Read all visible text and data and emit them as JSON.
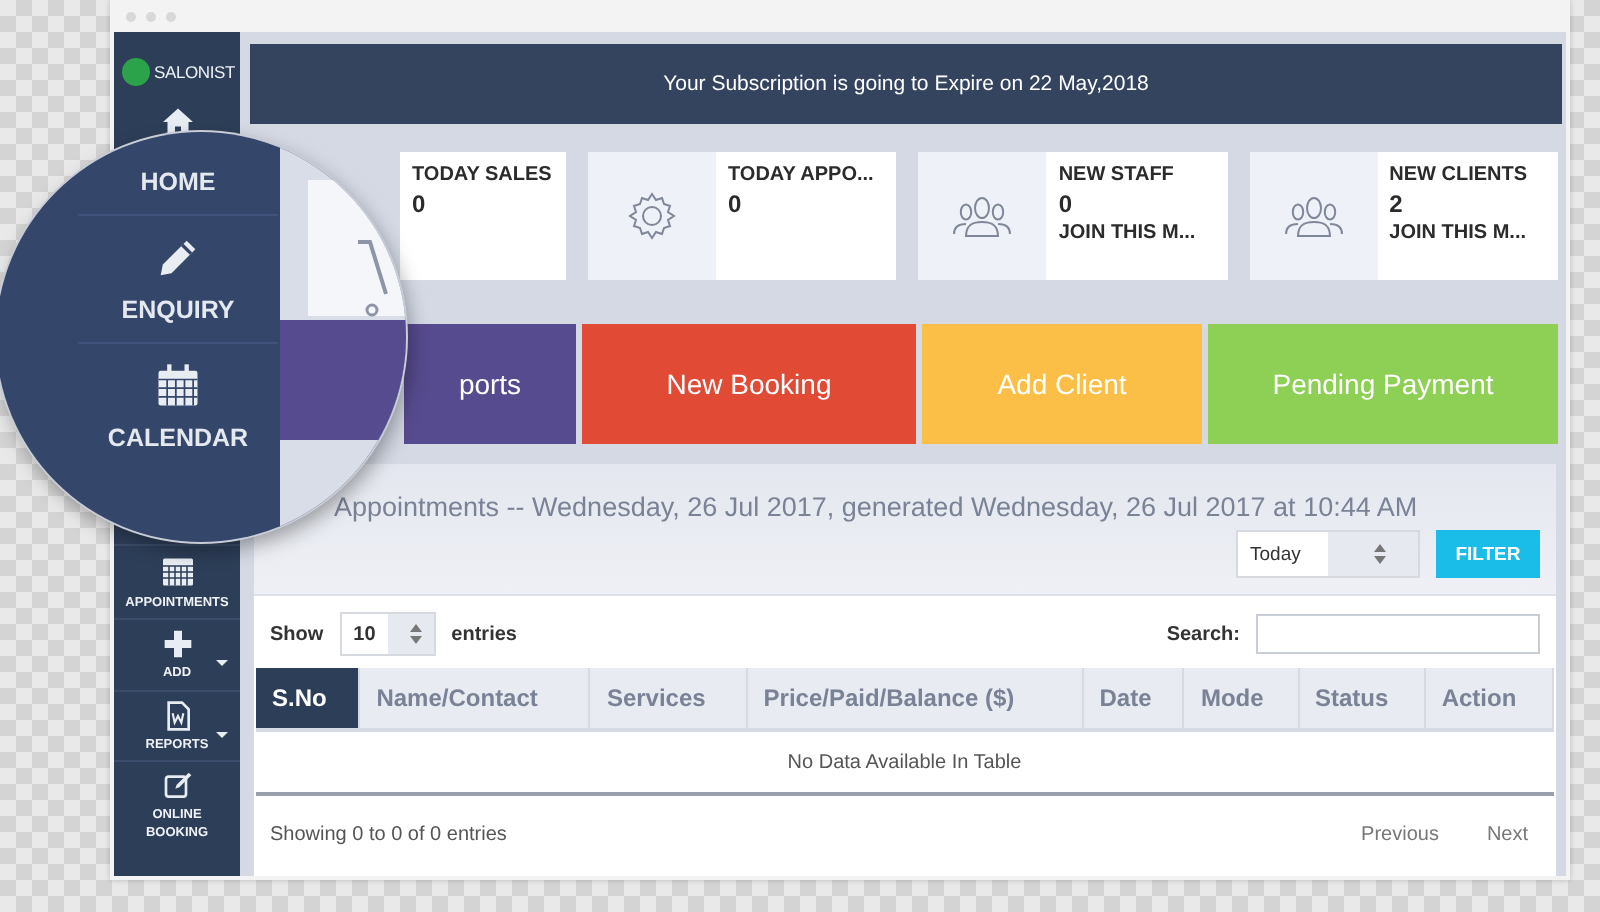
{
  "sidebar": {
    "logo": "SALONIST",
    "items": [
      {
        "label": "APPOINTMENTS",
        "has_menu": false
      },
      {
        "label": "ADD",
        "has_menu": true
      },
      {
        "label": "REPORTS",
        "has_menu": true
      },
      {
        "label": "ONLINE BOOKING",
        "has_menu": false
      }
    ]
  },
  "magnifier": {
    "items": [
      {
        "label": "HOME"
      },
      {
        "label": "ENQUIRY"
      },
      {
        "label": "CALENDAR"
      }
    ]
  },
  "banner": "Your Subscription is going to Expire on 22 May,2018",
  "stat_cards": [
    {
      "title": "TODAY SALES",
      "value": "0"
    },
    {
      "title": "TODAY APPO...",
      "value": "0"
    },
    {
      "title": "NEW STAFF",
      "value": "0",
      "note": "JOIN THIS M..."
    },
    {
      "title": "NEW CLIENTS",
      "value": "2",
      "note": "JOIN THIS M..."
    }
  ],
  "actions": [
    {
      "label": "ports",
      "color": "#574b8f"
    },
    {
      "label": "New Booking",
      "color": "#e14a35"
    },
    {
      "label": "Add Client",
      "color": "#fbbf47"
    },
    {
      "label": "Pending Payment",
      "color": "#8ecf55"
    }
  ],
  "appointments": {
    "title": "Appointments -- Wednesday, 26 Jul 2017, generated Wednesday, 26 Jul 2017 at 10:44 AM",
    "range": "Today",
    "filter_button": "FILTER",
    "show_label": "Show",
    "page_size": "10",
    "entries_label": "entries",
    "search_label": "Search:",
    "columns": [
      {
        "label": "S.No",
        "active": true
      },
      {
        "label": "Name/Contact",
        "active": false
      },
      {
        "label": "Services",
        "active": false
      },
      {
        "label": "Price/Paid/Balance ($)",
        "active": false
      },
      {
        "label": "Date",
        "active": false
      },
      {
        "label": "Mode",
        "active": false
      },
      {
        "label": "Status",
        "active": false
      },
      {
        "label": "Action",
        "active": false
      }
    ],
    "empty_message": "No Data Available In Table",
    "info": "Showing 0 to 0 of 0 entries",
    "pagination": [
      "Previous",
      "Next"
    ]
  }
}
